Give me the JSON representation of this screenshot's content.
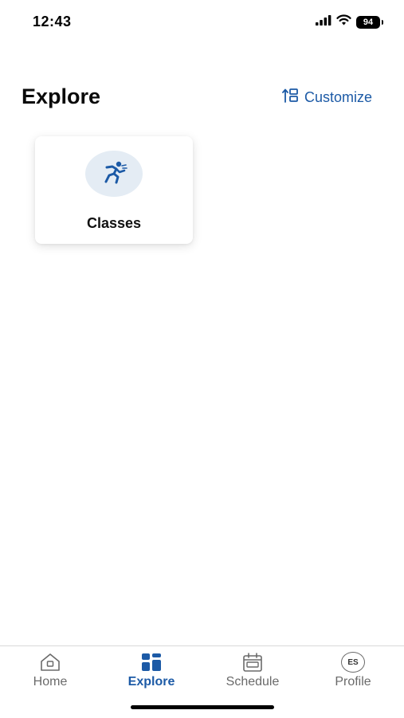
{
  "status_bar": {
    "time": "12:43",
    "battery": "94",
    "icons": [
      "signal-icon",
      "wifi-icon",
      "battery-icon"
    ]
  },
  "header": {
    "title": "Explore",
    "customize_label": "Customize",
    "customize_icon": "sort-layout-icon"
  },
  "cards": [
    {
      "label": "Classes",
      "icon": "running-person-icon"
    }
  ],
  "tab_bar": {
    "tabs": [
      {
        "label": "Home",
        "icon": "home-icon",
        "active": false
      },
      {
        "label": "Explore",
        "icon": "explore-grid-icon",
        "active": true
      },
      {
        "label": "Schedule",
        "icon": "calendar-icon",
        "active": false
      },
      {
        "label": "Profile",
        "icon": "avatar-icon",
        "active": false,
        "avatar_initials": "ES"
      }
    ]
  },
  "colors": {
    "accent": "#1c5aa6",
    "icon_bg": "#e4ecf4",
    "inactive": "#6a6a6a"
  }
}
